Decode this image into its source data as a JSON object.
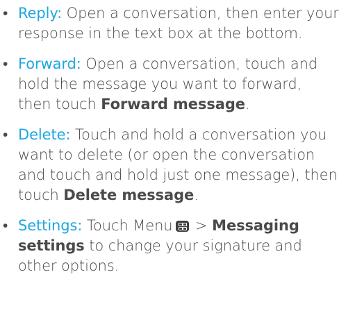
{
  "bullet": "•",
  "items": [
    {
      "term": "Reply:",
      "text": " Open a conversation, then enter your response in the text box at the bottom."
    },
    {
      "term": "Forward:",
      "text": " Open a conversation, touch and hold the message you want to forward, then touch ",
      "bold": "Forward message",
      "end": "."
    },
    {
      "term": "Delete:",
      "text": " Touch and hold a conversation you want to delete (or open the conversation and touch and hold just one message), then touch ",
      "bold": "Delete message",
      "end": "."
    },
    {
      "term": "Settings:",
      "text": " Touch Menu",
      "sep": " > ",
      "bold": "Messaging settings",
      "end": " to change your signature and other options.",
      "icon": "menu-key-icon"
    }
  ],
  "colors": {
    "term": "#1fa7df",
    "body": "#4a4a4a"
  }
}
